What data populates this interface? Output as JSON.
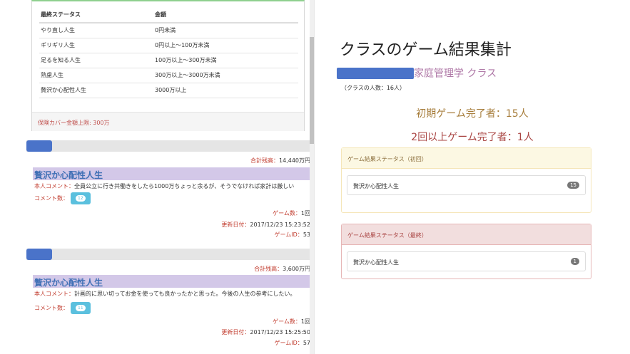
{
  "status_table": {
    "headers": [
      "最終ステータス",
      "金額"
    ],
    "rows": [
      [
        "やり直し人生",
        "0円未満"
      ],
      [
        "ギリギリ人生",
        "0円以上〜100万未満"
      ],
      [
        "足るを知る人生",
        "100万以上〜300万未満"
      ],
      [
        "熟慮人生",
        "300万以上〜3000万未満"
      ],
      [
        "贅沢か心配性人生",
        "3000万以上"
      ]
    ],
    "footer": "保険カバー金額上限: 300万"
  },
  "games": [
    {
      "progress": 0.09,
      "balance_label": "合計残高：",
      "balance_value": "14,440万円",
      "status_name": "贅沢か心配性人生",
      "comment_label": "本人コメント：",
      "comment_text": "全員公立に行き共働きをしたら1000万ちょっと余るが、そうでなければ家計は厳しい",
      "comment_count_label": "コメント数：",
      "comment_count": "12",
      "game_count_label": "ゲーム数：",
      "game_count": "1回",
      "updated_label": "更新日付：",
      "updated": "2017/12/23 15:23:52",
      "game_id_label": "ゲームID：",
      "game_id": "53"
    },
    {
      "progress": 0.09,
      "balance_label": "合計残高：",
      "balance_value": "3,600万円",
      "status_name": "贅沢か心配性人生",
      "comment_label": "本人コメント：",
      "comment_text": "計画的に思い切ってお金を使っても良かったかと思った。今後の人生の参考にしたい。",
      "comment_count_label": "コメント数：",
      "comment_count": "11",
      "game_count_label": "ゲーム数：",
      "game_count": "1回",
      "updated_label": "更新日付：",
      "updated": "2017/12/23 15:25:50",
      "game_id_label": "ゲームID：",
      "game_id": "57"
    }
  ],
  "summary": {
    "title": "クラスのゲーム結果集計",
    "class_name": "家庭管理学 クラス",
    "member_count": "（クラスの人数：16人）",
    "first_done": "初期ゲーム完了者：15人",
    "second_done": "2回以上ゲーム完了者：1人",
    "panel_first": {
      "heading": "ゲーム結果ステータス（初回）",
      "item_label": "贅沢か心配性人生",
      "item_count": "15"
    },
    "panel_final": {
      "heading": "ゲーム結果ステータス（最終）",
      "item_label": "贅沢か心配性人生",
      "item_count": "1"
    }
  },
  "colors": {
    "accent_blue": "#4a73c9",
    "status_bar": "#d3c8e8",
    "label_red": "#c0392b",
    "badge_blue": "#5bc0de"
  }
}
